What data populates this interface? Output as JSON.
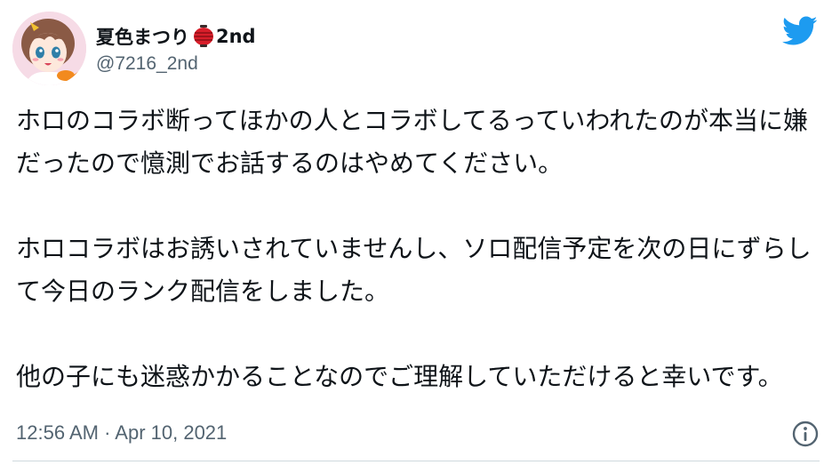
{
  "user": {
    "display_name": "夏色まつり",
    "name_emoji_icon": "red-paper-lantern-icon",
    "name_suffix": "2nd",
    "handle": "@7216_2nd"
  },
  "tweet": {
    "paragraphs": [
      "ホロのコラボ断ってほかの人とコラボしてるっていわれたのが本当に嫌だったので憶測でお話するのはやめてください。",
      "ホロコラボはお誘いされていませんし、ソロ配信予定を次の日にずらして今日のランク配信をしました。",
      "他の子にも迷惑かかることなのでご理解していただけると幸いです。"
    ],
    "timestamp": "12:56 AM · Apr 10, 2021"
  },
  "icons": {
    "logo": "twitter-bird-icon",
    "info": "info-icon"
  },
  "colors": {
    "brand": "#1d9bf0",
    "text_primary": "#0f1419",
    "text_secondary": "#536471",
    "lantern_red": "#d81e2a"
  }
}
